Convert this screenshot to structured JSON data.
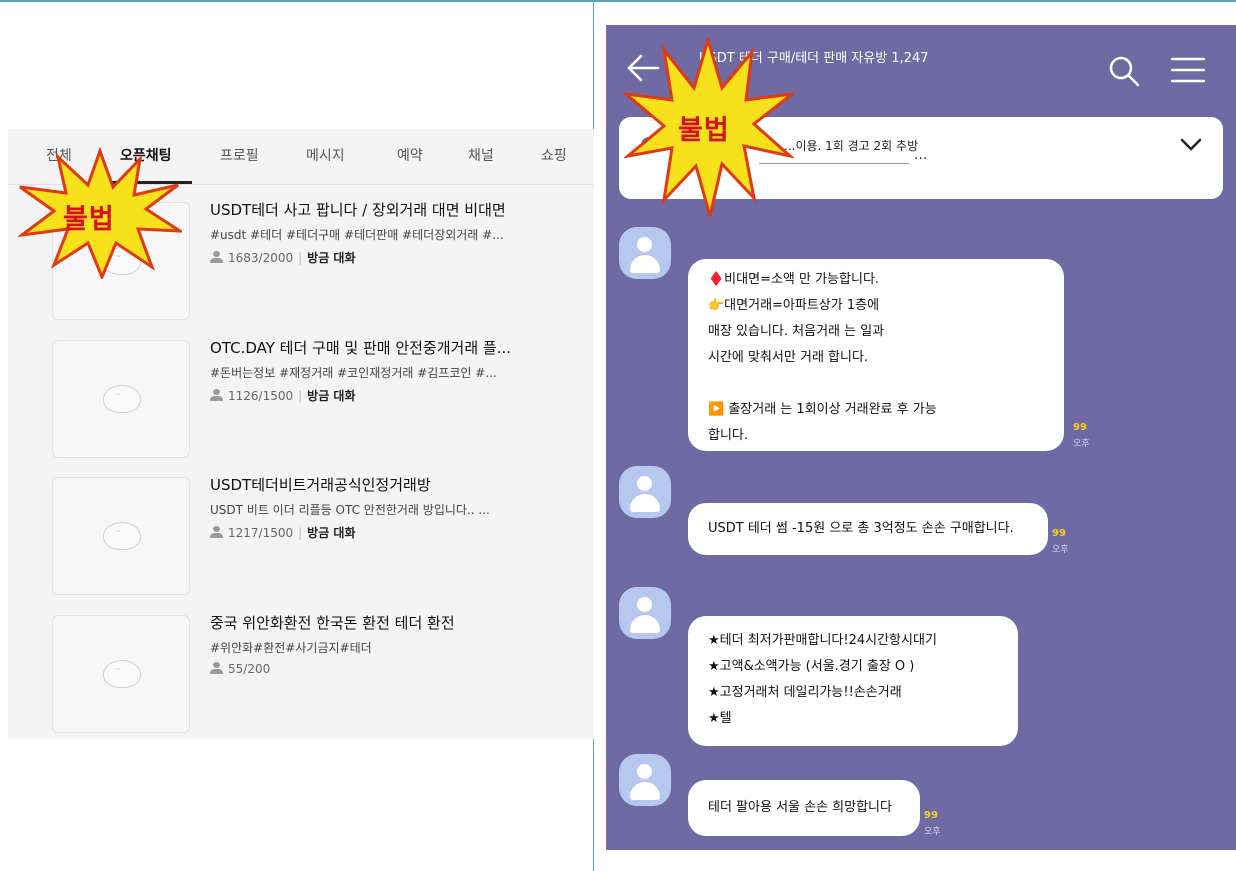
{
  "left": {
    "tabs": [
      {
        "label": "전체",
        "active": false
      },
      {
        "label": "오픈채팅",
        "active": true
      },
      {
        "label": "프로필",
        "active": false
      },
      {
        "label": "메시지",
        "active": false
      },
      {
        "label": "예약",
        "active": false
      },
      {
        "label": "채널",
        "active": false
      },
      {
        "label": "쇼핑",
        "active": false
      }
    ],
    "rooms": [
      {
        "title": "USDT테더 사고 팝니다 / 장외거래 대면 비대면",
        "tags": "#usdt #테더 #테더구매 #테더판매 #테더장외거래 #...",
        "members": "1683/2000",
        "status": "방금 대화"
      },
      {
        "title": "OTC.DAY 테더 구매 및 판매 안전중개거래 플...",
        "tags": "#돈버는정보 #재정거래 #코인재정거래 #김프코인 #...",
        "members": "1126/1500",
        "status": "방금 대화"
      },
      {
        "title": "USDT테더비트거래공식인정거래방",
        "tags": "USDT 비트 이더 리플등 OTC 안전한거래 방입니다.. ...",
        "members": "1217/1500",
        "status": "방금 대화"
      },
      {
        "title": "중국 위안화환전 한국돈 환전 테더 환전",
        "tags": "#위안화#환전#사기금지#테더",
        "members": "55/200",
        "status": ""
      }
    ],
    "burst_label": "불법"
  },
  "right": {
    "chat_title": "USDT 테더 구매/테더 판매 자유방 1,247",
    "burst_label": "불법",
    "notice_text": "...이용. 1회 경고 2회 추방",
    "notice_more": "···",
    "messages": [
      {
        "lines": [
          "♦️비대면=소액 만 가능합니다.",
          "👉대면거래=아파트상가 1층에",
          "매장 있습니다. 처음거래 는 일과",
          "시간에 맞춰서만 거래 합니다.",
          "",
          "▶️                    출장거래 는 1회이상 거래완료 후 가능",
          "합니다."
        ],
        "read": "99",
        "time": "오후"
      },
      {
        "lines": [
          "USDT 테더 썸 -15원 으로 총 3억정도 손손 구매합니다."
        ],
        "read": "99",
        "time": "오후"
      },
      {
        "lines": [
          "★테더 최저가판매합니다!24시간항시대기",
          "★고액&소액가능 (서울.경기 출장 O )",
          "★고정거래처 데일리가능!!손손거래",
          "★텔"
        ],
        "read": "",
        "time": ""
      },
      {
        "lines": [
          "테더 팔아용 서울 손손 희망합니다"
        ],
        "read": "99",
        "time": "오후"
      }
    ]
  }
}
